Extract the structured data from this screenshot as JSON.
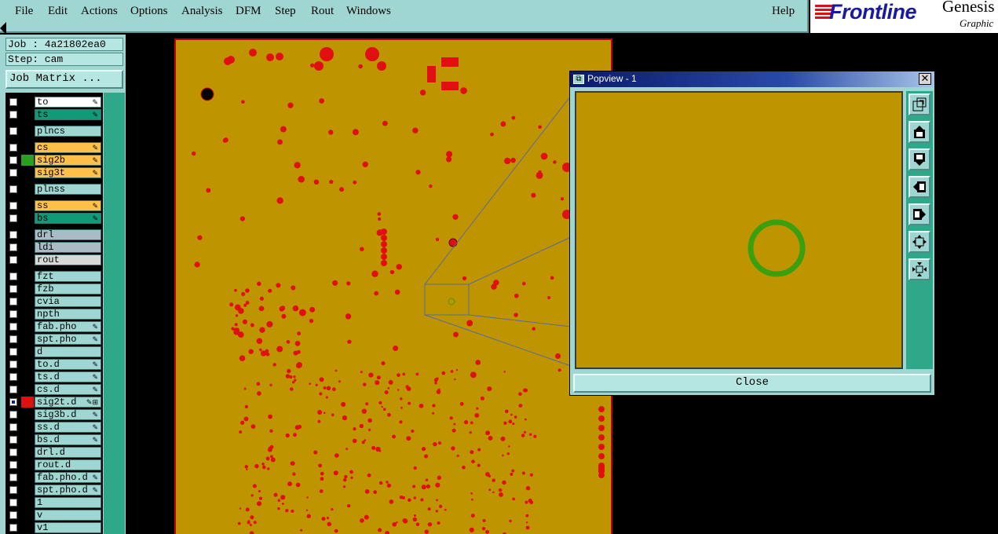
{
  "menu": {
    "file": "File",
    "edit": "Edit",
    "actions": "Actions",
    "options": "Options",
    "analysis": "Analysis",
    "dfm": "DFM",
    "step": "Step",
    "rout": "Rout",
    "windows": "Windows",
    "help": "Help"
  },
  "brand": {
    "logo": "Frontline",
    "product": "Genesis",
    "subtitle": "Graphic"
  },
  "job": {
    "job_label": "Job : 4a21802ea0",
    "step_label": "Step: cam",
    "matrix_button": "Job Matrix ..."
  },
  "layers": [
    {
      "name": "to",
      "bg": "#ffffff",
      "swatch": "#000000",
      "icon": "✎",
      "checked": false
    },
    {
      "name": "ts",
      "bg": "#0f9a78",
      "swatch": "#000000",
      "icon": "✎",
      "checked": false
    },
    {
      "name": "plncs",
      "bg": "#9fd6d2",
      "swatch": "#000000",
      "icon": "",
      "checked": false
    },
    {
      "name": "cs",
      "bg": "#ffc04a",
      "swatch": "#000000",
      "icon": "✎",
      "checked": false
    },
    {
      "name": "sig2b",
      "bg": "#ffc04a",
      "swatch": "#2aa020",
      "icon": "✎",
      "checked": false
    },
    {
      "name": "sig3t",
      "bg": "#ffc04a",
      "swatch": "#000000",
      "icon": "✎",
      "checked": false
    },
    {
      "name": "plnss",
      "bg": "#9fd6d2",
      "swatch": "#000000",
      "icon": "",
      "checked": false
    },
    {
      "name": "ss",
      "bg": "#ffc04a",
      "swatch": "#000000",
      "icon": "✎",
      "checked": false
    },
    {
      "name": "bs",
      "bg": "#0f9a78",
      "swatch": "#000000",
      "icon": "✎",
      "checked": false
    },
    {
      "name": "drl",
      "bg": "#a9bcc6",
      "swatch": "#000000",
      "icon": "",
      "checked": false
    },
    {
      "name": "ldi",
      "bg": "#a9bcc6",
      "swatch": "#000000",
      "icon": "",
      "checked": false
    },
    {
      "name": "rout",
      "bg": "#d8d8d8",
      "swatch": "#000000",
      "icon": "",
      "checked": false
    },
    {
      "name": "fzt",
      "bg": "#9fd6d2",
      "swatch": "#000000",
      "icon": "",
      "checked": false
    },
    {
      "name": "fzb",
      "bg": "#9fd6d2",
      "swatch": "#000000",
      "icon": "",
      "checked": false
    },
    {
      "name": "cvia",
      "bg": "#9fd6d2",
      "swatch": "#000000",
      "icon": "",
      "checked": false
    },
    {
      "name": "npth",
      "bg": "#9fd6d2",
      "swatch": "#000000",
      "icon": "",
      "checked": false
    },
    {
      "name": "fab.pho",
      "bg": "#9fd6d2",
      "swatch": "#000000",
      "icon": "✎",
      "checked": false
    },
    {
      "name": "spt.pho",
      "bg": "#9fd6d2",
      "swatch": "#000000",
      "icon": "✎",
      "checked": false
    },
    {
      "name": "d",
      "bg": "#9fd6d2",
      "swatch": "#000000",
      "icon": "",
      "checked": false
    },
    {
      "name": "to.d",
      "bg": "#9fd6d2",
      "swatch": "#000000",
      "icon": "✎",
      "checked": false
    },
    {
      "name": "ts.d",
      "bg": "#9fd6d2",
      "swatch": "#000000",
      "icon": "✎",
      "checked": false
    },
    {
      "name": "cs.d",
      "bg": "#9fd6d2",
      "swatch": "#000000",
      "icon": "✎",
      "checked": false
    },
    {
      "name": "sig2t.d",
      "bg": "#9fd6d2",
      "swatch": "#e01010",
      "icon": "✎⊞",
      "checked": true
    },
    {
      "name": "sig3b.d",
      "bg": "#9fd6d2",
      "swatch": "#000000",
      "icon": "✎",
      "checked": false
    },
    {
      "name": "ss.d",
      "bg": "#9fd6d2",
      "swatch": "#000000",
      "icon": "✎",
      "checked": false
    },
    {
      "name": "bs.d",
      "bg": "#9fd6d2",
      "swatch": "#000000",
      "icon": "✎",
      "checked": false
    },
    {
      "name": "drl.d",
      "bg": "#9fd6d2",
      "swatch": "#000000",
      "icon": "",
      "checked": false
    },
    {
      "name": "rout.d",
      "bg": "#9fd6d2",
      "swatch": "#000000",
      "icon": "",
      "checked": false
    },
    {
      "name": "fab.pho.d",
      "bg": "#9fd6d2",
      "swatch": "#000000",
      "icon": "✎",
      "checked": false
    },
    {
      "name": "spt.pho.d",
      "bg": "#9fd6d2",
      "swatch": "#000000",
      "icon": "✎",
      "checked": false
    },
    {
      "name": "1",
      "bg": "#9fd6d2",
      "swatch": "#000000",
      "icon": "",
      "checked": false
    },
    {
      "name": "v",
      "bg": "#9fd6d2",
      "swatch": "#000000",
      "icon": "",
      "checked": false
    },
    {
      "name": "v1",
      "bg": "#9fd6d2",
      "swatch": "#000000",
      "icon": "",
      "checked": false
    }
  ],
  "popview": {
    "title": "Popview - 1",
    "close_button": "Close",
    "tools": [
      "zoom-window-icon",
      "pan-up-icon",
      "pan-down-icon",
      "pan-left-icon",
      "pan-right-icon",
      "zoom-out-icon",
      "zoom-in-icon"
    ]
  },
  "colors": {
    "board": "#be9500",
    "pad": "#e01010",
    "highlight_ring": "#3aa010",
    "panel": "#9fd6d2"
  }
}
